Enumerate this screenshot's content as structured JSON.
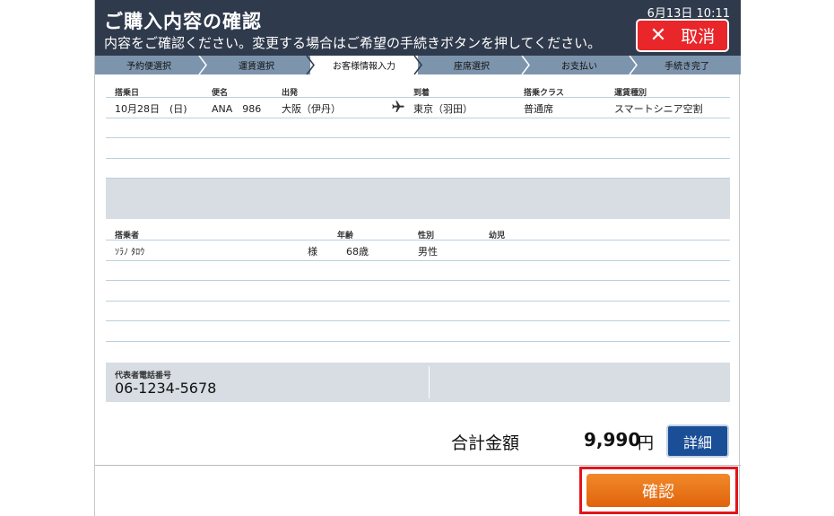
{
  "header": {
    "title": "ご購入内容の確認",
    "subtitle": "内容をご確認ください。変更する場合はご希望の手続きボタンを押してください。",
    "datetime": "6月13日  10:11",
    "cancel_label": "取消"
  },
  "steps": [
    {
      "label": "予約便選択",
      "active": false
    },
    {
      "label": "運賃選択",
      "active": false
    },
    {
      "label": "お客様情報入力",
      "active": true
    },
    {
      "label": "座席選択",
      "active": false
    },
    {
      "label": "お支払い",
      "active": false
    },
    {
      "label": "手続き完了",
      "active": false
    }
  ],
  "flight_table": {
    "headers": {
      "date": "搭乗日",
      "flight": "便名",
      "departure": "出発",
      "arrival": "到着",
      "class": "搭乗クラス",
      "fare": "運賃種別"
    },
    "rows": [
      {
        "date": "10月28日　(日)",
        "flight": "ANA　986",
        "departure": "大阪（伊丹）",
        "arrival": "東京（羽田）",
        "class": "普通席",
        "fare": "スマートシニア空割"
      }
    ]
  },
  "passenger_table": {
    "headers": {
      "name": "搭乗者",
      "age": "年齢",
      "gender": "性別",
      "infant": "幼児"
    },
    "rows": [
      {
        "name": "ｿﾗﾉ ﾀﾛｳ",
        "honorific": "様",
        "age": "68歳",
        "gender": "男性",
        "infant": ""
      }
    ]
  },
  "contact": {
    "label": "代表者電話番号",
    "phone": "06-1234-5678"
  },
  "total": {
    "label": "合計金額",
    "amount": "9,990",
    "unit": "円",
    "detail_label": "詳細"
  },
  "confirm_label": "確認",
  "colors": {
    "header_bg": "#2f3a4c",
    "steps_bg": "#7d94ad",
    "cancel": "#e9262a",
    "detail": "#1a4e96",
    "confirm": "#ee7a1c",
    "highlight": "#e3141a"
  }
}
